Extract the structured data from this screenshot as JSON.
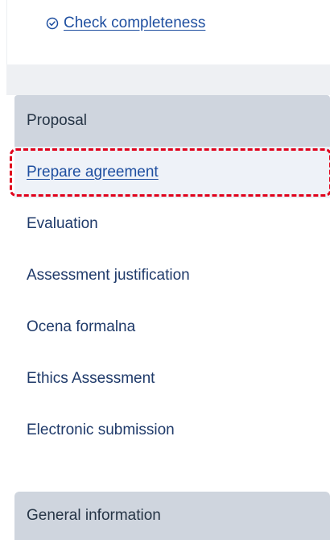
{
  "top": {
    "check_link_label": "Check completeness",
    "check_icon": "check-circle-icon"
  },
  "menu": {
    "header_label": "Proposal",
    "items": [
      {
        "label": "Prepare agreement",
        "active": true
      },
      {
        "label": "Evaluation"
      },
      {
        "label": "Assessment justification"
      },
      {
        "label": "Ocena formalna"
      },
      {
        "label": "Ethics Assessment"
      },
      {
        "label": "Electronic submission"
      }
    ],
    "footer_label": "General information"
  },
  "colors": {
    "link": "#1f4fa0",
    "section_header_bg": "#cfd5de",
    "highlight_border": "#e0001b",
    "active_item_bg": "#eef2f8"
  }
}
